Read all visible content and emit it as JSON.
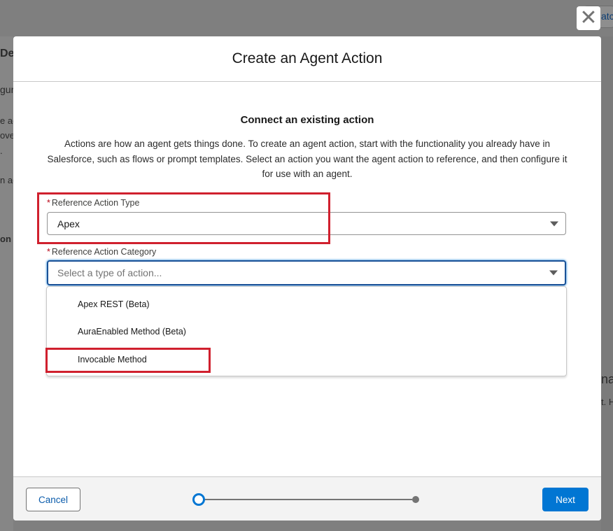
{
  "modal": {
    "title": "Create an Agent Action",
    "section_title": "Connect an existing action",
    "description": "Actions are how an agent gets things done. To create an agent action, start with the functionality you already have in Salesforce, such as flows or prompt templates. Select an action you want the agent action to reference, and then configure it for use with an agent."
  },
  "fields": {
    "reference_action_type": {
      "required_marker": "*",
      "label": "Reference Action Type",
      "value": "Apex"
    },
    "reference_action_category": {
      "required_marker": "*",
      "label": "Reference Action Category",
      "placeholder": "Select a type of action..."
    }
  },
  "dropdown": {
    "options": [
      {
        "label": "Apex REST (Beta)"
      },
      {
        "label": "AuraEnabled Method (Beta)"
      },
      {
        "label": "Invocable Method"
      }
    ]
  },
  "footer": {
    "cancel_label": "Cancel",
    "next_label": "Next",
    "progress": {
      "current_step": 1,
      "total_steps": 2
    }
  },
  "icons": {
    "close": "close-icon",
    "caret": "chevron-down-icon"
  },
  "background": {
    "left_fragments": [
      "De",
      "gur",
      "e ac",
      "ove",
      ".",
      "n ac",
      "on D"
    ],
    "right_fragments": [
      "atc",
      "na",
      "t. H"
    ]
  },
  "colors": {
    "brand": "#0176d3",
    "highlight": "#d0202e",
    "required": "#ba0517"
  }
}
